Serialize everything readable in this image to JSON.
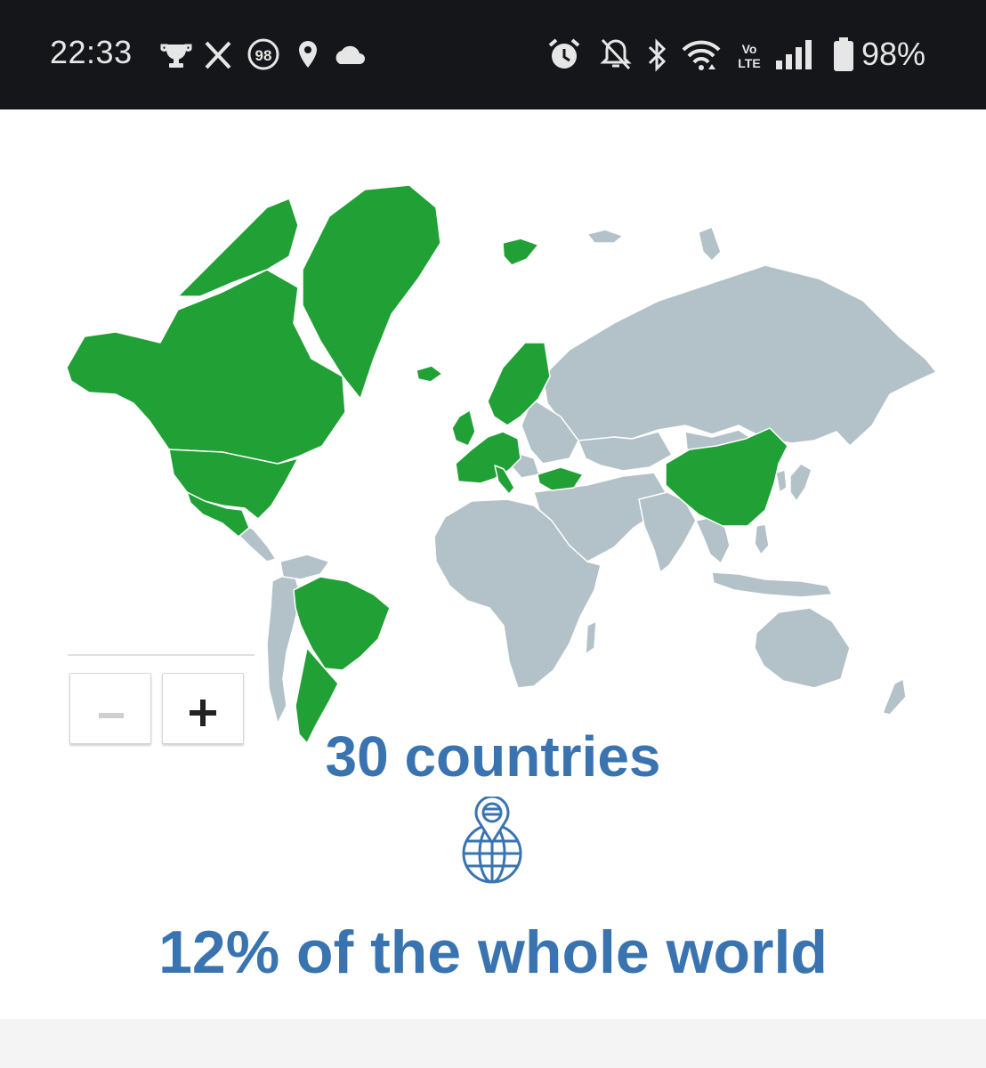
{
  "status_bar": {
    "time": "22:33",
    "notification_badge": "98",
    "battery_percent": "98%",
    "left_icons": [
      "trophy-icon",
      "x-icon",
      "badge-98-icon",
      "location-pin-icon",
      "cloud-icon"
    ],
    "right_icons": [
      "alarm-icon",
      "bell-off-icon",
      "bluetooth-icon",
      "wifi-icon",
      "volte-icon",
      "signal-icon",
      "battery-icon"
    ],
    "volte_text": "Vo LTE"
  },
  "map": {
    "zoom_out_label": "−",
    "zoom_in_label": "+",
    "colors": {
      "visited": "#20a035",
      "not_visited": "#b3c2c8",
      "border": "#ffffff"
    },
    "highlighted_regions": [
      "Canada",
      "United States",
      "Mexico",
      "Greenland",
      "Iceland",
      "Svalbard",
      "Norway",
      "Sweden",
      "Finland",
      "United Kingdom",
      "Ireland",
      "France",
      "Spain",
      "Belgium",
      "Netherlands",
      "Germany",
      "Switzerland",
      "Austria",
      "Czechia",
      "Italy",
      "Hungary",
      "Turkey",
      "China",
      "Brazil",
      "Argentina",
      "Uruguay"
    ]
  },
  "stats": {
    "countries_label": "30 countries",
    "world_share_label": "12% of the whole world",
    "accent_color": "#3a74b0"
  }
}
